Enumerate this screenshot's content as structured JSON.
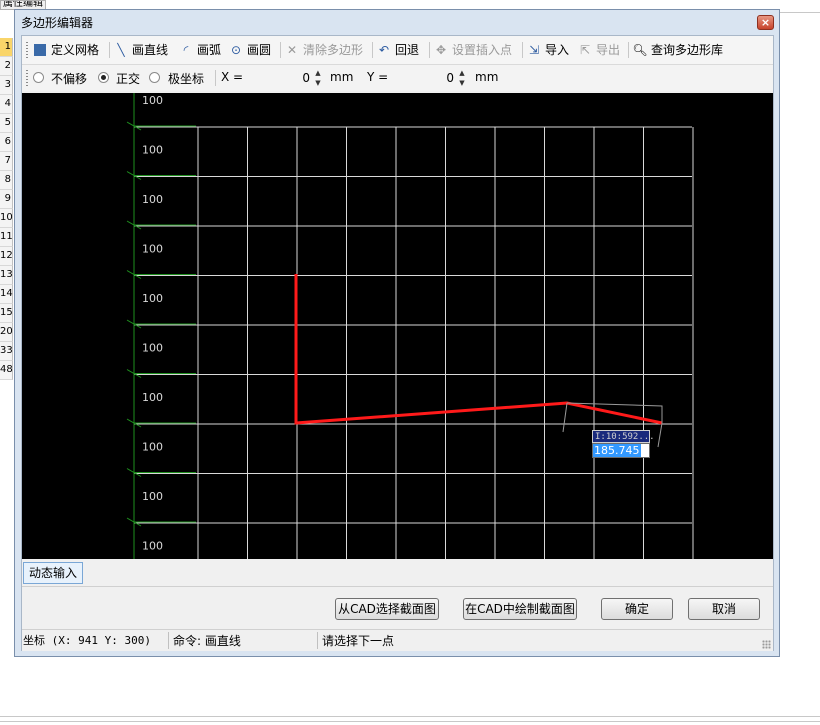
{
  "background": {
    "tab_label": "属性编辑",
    "row_numbers": [
      "1",
      "2",
      "3",
      "4",
      "5",
      "6",
      "7",
      "8",
      "9",
      "10",
      "11",
      "12",
      "13",
      "14",
      "15",
      "20",
      "33",
      "48"
    ],
    "active_row": "1"
  },
  "dialog": {
    "title": "多边形编辑器",
    "close_label": "×"
  },
  "toolbar": {
    "define_grid": "定义网格",
    "draw_line": "画直线",
    "draw_arc": "画弧",
    "draw_circle": "画圆",
    "clear_polygon": "清除多边形",
    "undo": "回退",
    "set_insert_point": "设置插入点",
    "import": "导入",
    "export": "导出",
    "query_library": "查询多边形库"
  },
  "options": {
    "no_offset": "不偏移",
    "orthogonal": "正交",
    "polar": "极坐标",
    "selected_mode": "orthogonal",
    "x_label": "X =",
    "x_value": "0",
    "x_unit": "mm",
    "y_label": "Y =",
    "y_value": "0",
    "y_unit": "mm"
  },
  "canvas": {
    "background": "#000000",
    "grid_color": "#d9d9d9",
    "ruler_color": "#1e8f1e",
    "polygon_color": "#ff1a1a",
    "ruler_labels": [
      "100",
      "100",
      "100",
      "100",
      "100",
      "100",
      "100",
      "100",
      "100",
      "100"
    ],
    "dynamic_hint": "I:10:592...",
    "dynamic_input": "185.745"
  },
  "dynamic_input_tab": "动态输入",
  "buttons": {
    "select_from_cad": "从CAD选择截面图",
    "draw_in_cad": "在CAD中绘制截面图",
    "ok": "确定",
    "cancel": "取消"
  },
  "status": {
    "coords": "坐标 (X: 941 Y: 300)",
    "command": "命令: 画直线",
    "prompt": "请选择下一点"
  }
}
